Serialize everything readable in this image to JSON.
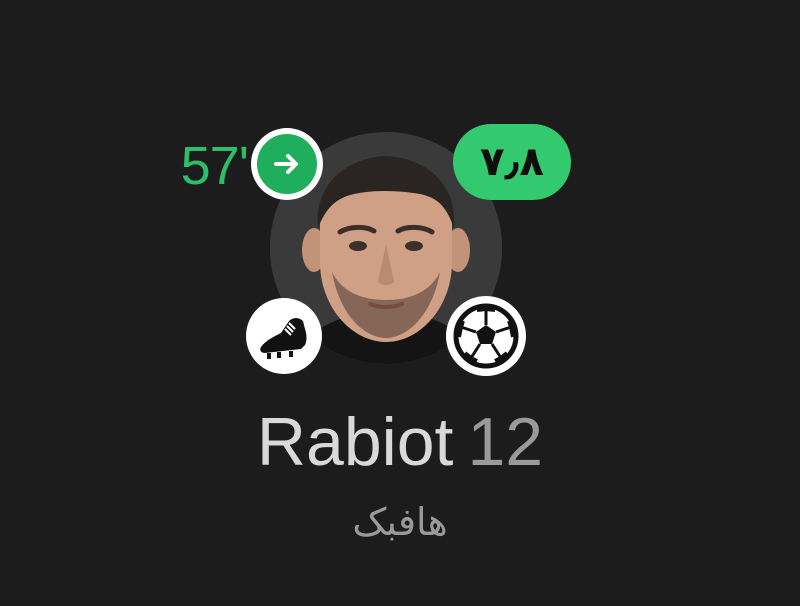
{
  "player": {
    "name": "Rabiot",
    "number": "12",
    "position": "هافبک",
    "rating": "۷٫۸",
    "substitution_minute": "57'"
  },
  "icons": {
    "substitution": "arrow-right-icon",
    "assist": "football-boot-icon",
    "goal": "football-ball-icon"
  },
  "colors": {
    "background": "#1c1c1c",
    "accent_green": "#32c96f",
    "sub_green": "#1fae5c",
    "text_light": "#d9d9d9",
    "text_muted": "#9a9a9a"
  }
}
